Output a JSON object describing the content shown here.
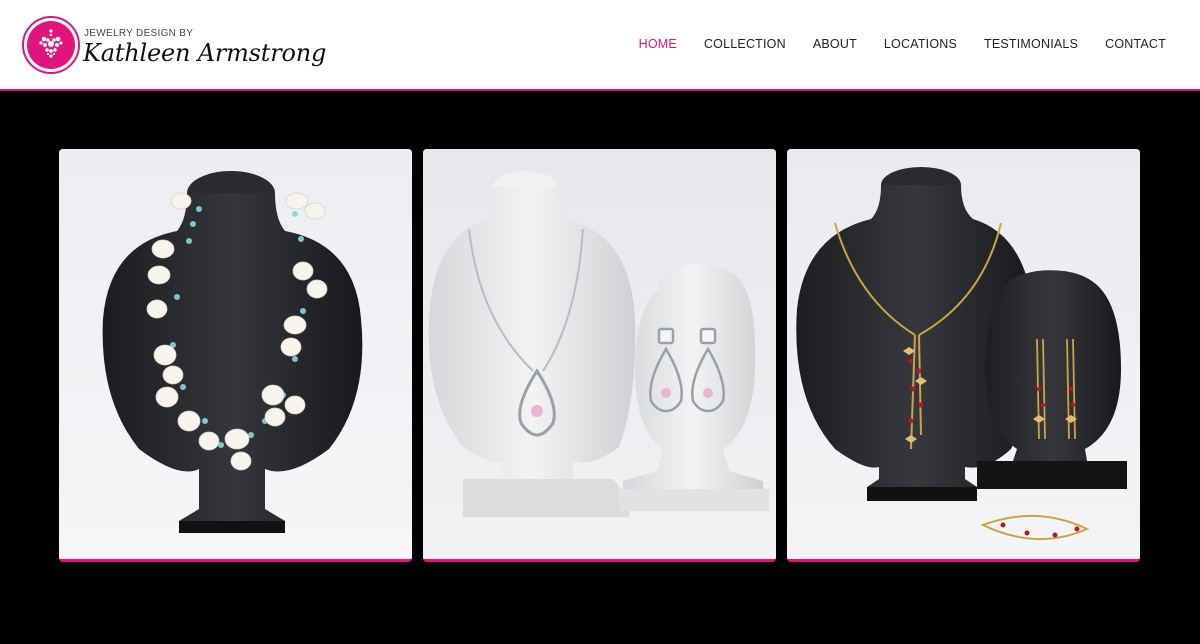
{
  "brand": {
    "tagline": "JEWELRY DESIGN BY",
    "name": "Kathleen Armstrong",
    "accent_color": "#e0147a"
  },
  "nav": {
    "items": [
      {
        "label": "HOME",
        "active": true
      },
      {
        "label": "COLLECTION",
        "active": false
      },
      {
        "label": "ABOUT",
        "active": false
      },
      {
        "label": "LOCATIONS",
        "active": false
      },
      {
        "label": "TESTIMONIALS",
        "active": false
      },
      {
        "label": "CONTACT",
        "active": false
      }
    ]
  },
  "gallery": {
    "images": [
      {
        "subject": "pearl-petal-necklace-on-black-bust"
      },
      {
        "subject": "silver-teardrop-necklace-and-earrings-on-white-busts"
      },
      {
        "subject": "gold-butterfly-necklace-earrings-bracelet-on-black-busts"
      }
    ]
  }
}
